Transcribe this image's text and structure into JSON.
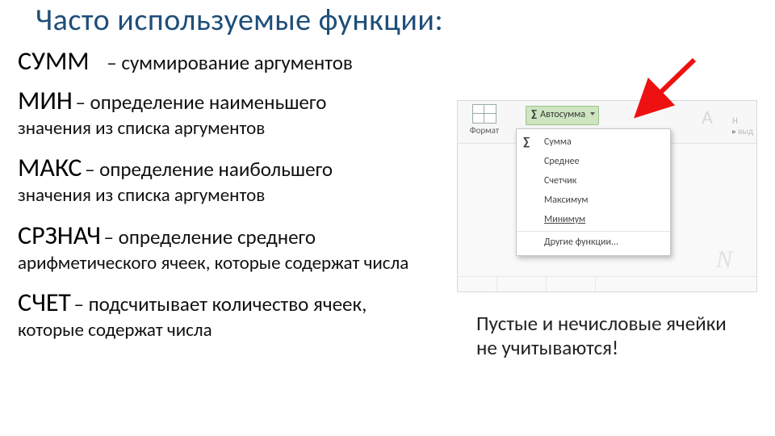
{
  "title": "Часто используемые функции:",
  "funcs": [
    {
      "name": "СУММ",
      "first": "– суммирование аргументов",
      "rest": ""
    },
    {
      "name": "МИН",
      "first": "– определение наименьшего",
      "rest": "значения из списка аргументов"
    },
    {
      "name": "МАКС",
      "first": "– определение наибольшего",
      "rest": "значения из списка аргументов"
    },
    {
      "name": "СРЗНАЧ",
      "first": "– определение среднего",
      "rest": "арифметического ячеек, которые содержат числа"
    },
    {
      "name": "СЧЕТ",
      "first": "– подсчитывает количество ячеек,",
      "rest": "которые содержат числа"
    }
  ],
  "ribbon": {
    "format_label": "Формат",
    "autosum_label": "Автосумма",
    "ghost_right_1": "Н",
    "ghost_right_2": "выд"
  },
  "menu": {
    "items": [
      "Сумма",
      "Среднее",
      "Счетчик",
      "Максимум",
      "Минимум",
      "Другие функции..."
    ]
  },
  "note": "Пустые и нечисловые ячейки не учитываются!",
  "dashes": {
    "d": "–"
  }
}
